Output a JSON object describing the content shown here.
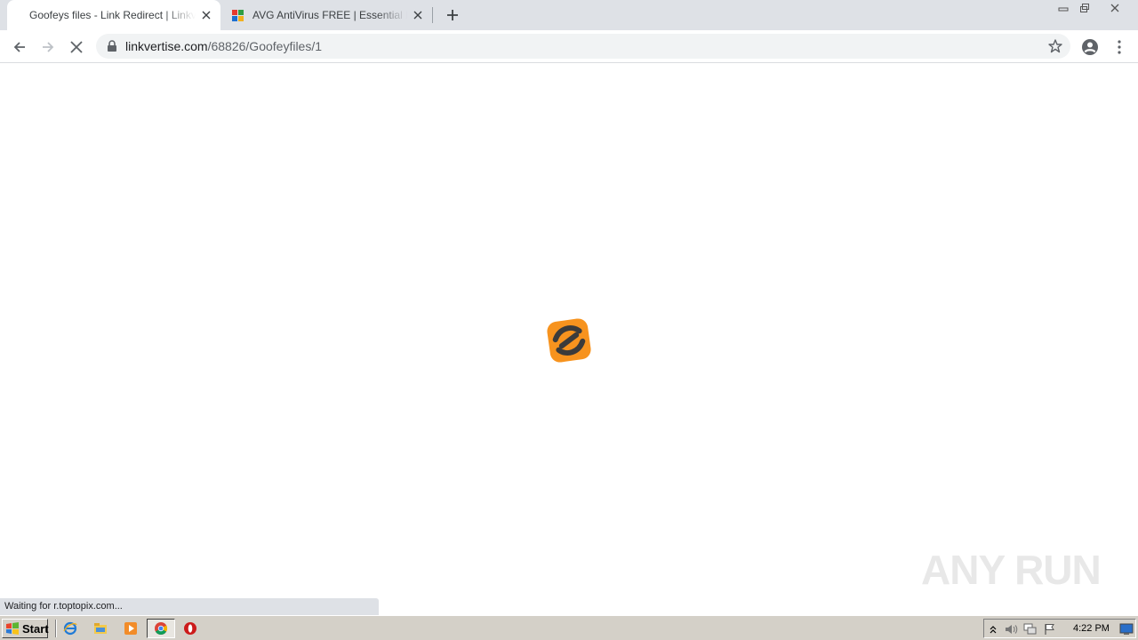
{
  "browser": {
    "tabs": [
      {
        "title": "Goofeys files - Link Redirect | Linkvertise",
        "active": true,
        "favicon": "blank-favicon"
      },
      {
        "title": "AVG AntiVirus FREE | Essential basic protection",
        "active": false,
        "favicon": "avg-favicon"
      }
    ],
    "new_tab_label": "+",
    "url_host": "linkvertise.com",
    "url_path": "/68826/Goofeyfiles/1",
    "toolbar_icons": [
      "back-arrow-icon",
      "forward-arrow-icon",
      "stop-icon",
      "lock-icon",
      "star-icon",
      "profile-icon",
      "menu-icon"
    ]
  },
  "page": {
    "logo": "linkvertise-logo",
    "accent_color": "#f7931e",
    "status_text": "Waiting for r.toptopix.com...",
    "watermark_text": "ANY RUN"
  },
  "taskbar": {
    "start_label": "Start",
    "quick_launch": [
      "ie-icon",
      "explorer-icon",
      "media-player-icon",
      "chrome-icon",
      "opera-icon"
    ],
    "tray_icons": [
      "arrow-up-icon",
      "volume-icon",
      "network-icon",
      "flag-icon",
      "desktop-icon"
    ],
    "clock": "4:22 PM"
  }
}
